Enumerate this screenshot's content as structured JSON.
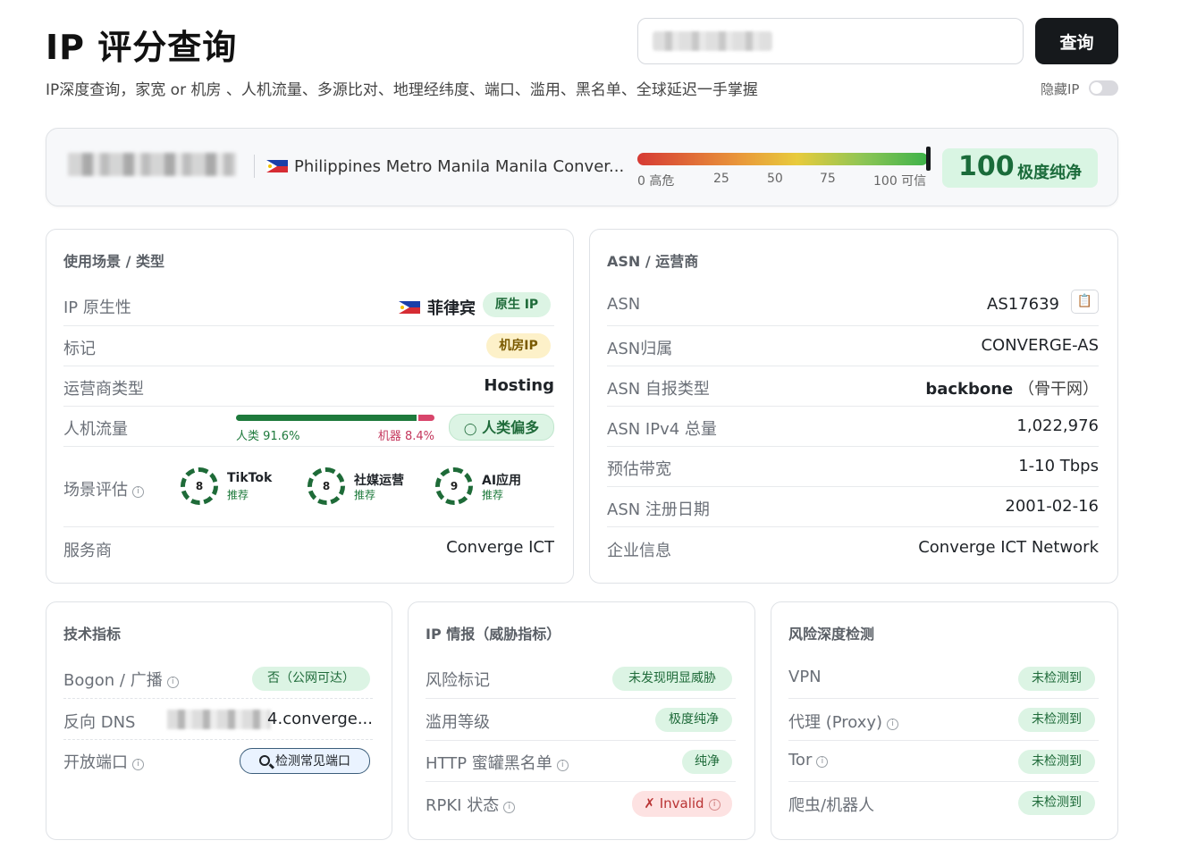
{
  "header": {
    "title": "IP 评分查询",
    "subtitle": "IP深度查询，家宽 or 机房 、人机流量、多源比对、地理经纬度、端口、滥用、黑名单、全球延迟一手掌握",
    "search_button": "查询",
    "hide_ip_label": "隐藏IP",
    "hide_ip_enabled": false
  },
  "summary": {
    "location": "Philippines Metro Manila Manila Conver...",
    "gauge_ticks": [
      "0 高危",
      "25",
      "50",
      "75",
      "100 可信"
    ],
    "gauge_value": 100,
    "score": "100",
    "score_label": "极度纯净"
  },
  "usage": {
    "title": "使用场景 / 类型",
    "native_label": "IP 原生性",
    "native_country": "菲律宾",
    "native_badge": "原生 IP",
    "tag_label": "标记",
    "tag_badge": "机房IP",
    "carrier_type_label": "运营商类型",
    "carrier_type_value": "Hosting",
    "traffic_label": "人机流量",
    "traffic_human_text": "人类 91.6%",
    "traffic_bot_text": "机器 8.4%",
    "traffic_human_pct": 91.6,
    "traffic_bot_pct": 8.4,
    "traffic_badge": "人类偏多",
    "scene_label": "场景评估",
    "scenes": [
      {
        "score": "8",
        "name": "TikTok",
        "status": "推荐"
      },
      {
        "score": "8",
        "name": "社媒运营",
        "status": "推荐"
      },
      {
        "score": "9",
        "name": "AI应用",
        "status": "推荐"
      }
    ],
    "provider_label": "服务商",
    "provider_value": "Converge ICT"
  },
  "asn": {
    "title": "ASN / 运营商",
    "rows": [
      {
        "label": "ASN",
        "value": "AS17639"
      },
      {
        "label": "ASN归属",
        "value": "CONVERGE-AS"
      },
      {
        "label": "ASN 自报类型",
        "value": "backbone",
        "extra": "（骨干网）"
      },
      {
        "label": "ASN IPv4 总量",
        "value": "1,022,976"
      },
      {
        "label": "预估带宽",
        "value": "1-10 Tbps"
      },
      {
        "label": "ASN 注册日期",
        "value": "2001-02-16"
      },
      {
        "label": "企业信息",
        "value": "Converge ICT Network"
      }
    ]
  },
  "tech": {
    "title": "技术指标",
    "bogon_label": "Bogon / 广播",
    "bogon_badge": "否（公网可达）",
    "rdns_label": "反向 DNS",
    "rdns_value": "4.converge...",
    "ports_label": "开放端口",
    "ports_button": "检测常见端口"
  },
  "intel": {
    "title": "IP 情报（威胁指标）",
    "risk_label": "风险标记",
    "risk_badge": "未发现明显威胁",
    "abuse_label": "滥用等级",
    "abuse_badge": "极度纯净",
    "honeypot_label": "HTTP 蜜罐黑名单",
    "honeypot_badge": "纯净",
    "rpki_label": "RPKI 状态",
    "rpki_badge": "✗ Invalid"
  },
  "deep": {
    "title": "风险深度检测",
    "rows": [
      {
        "label": "VPN",
        "badge": "未检测到"
      },
      {
        "label": "代理 (Proxy)",
        "badge": "未检测到"
      },
      {
        "label": "Tor",
        "badge": "未检测到"
      },
      {
        "label": "爬虫/机器人",
        "badge": "未检测到"
      }
    ]
  },
  "colors": {
    "score_green": "#1a6b3a",
    "badge_green_bg": "#dcf4e4",
    "human_bar": "#1e7a3c",
    "bot_bar": "#d8456b",
    "rpki_red": "#b93434"
  }
}
